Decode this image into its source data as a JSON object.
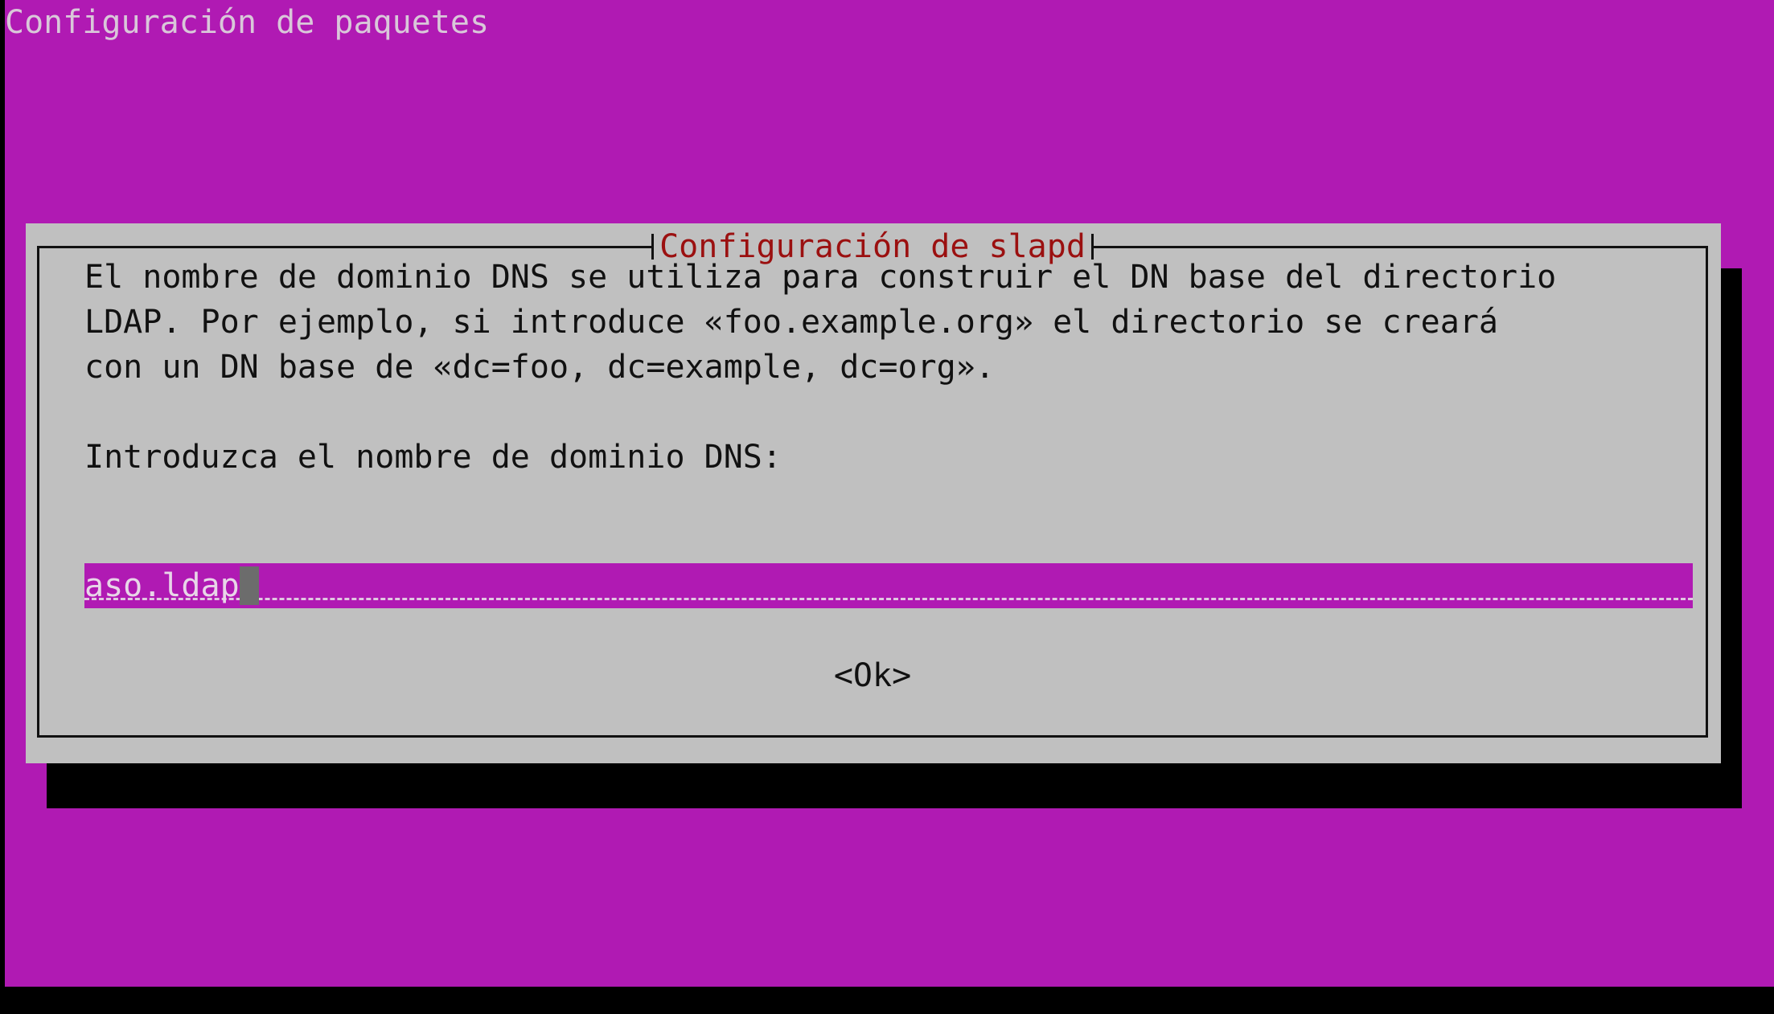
{
  "screen": {
    "backtitle": "Configuración de paquetes"
  },
  "dialog": {
    "title": "Configuración de slapd",
    "description_lines": [
      "El nombre de dominio DNS se utiliza para construir el DN base del directorio",
      "LDAP. Por ejemplo, si introduce «foo.example.org» el directorio se creará",
      "con un DN base de «dc=foo, dc=example, dc=org»."
    ],
    "prompt": "Introduzca el nombre de dominio DNS:",
    "input_value": "aso.ldap",
    "ok_label": "<Ok>"
  },
  "colors": {
    "background": "#b01ab3",
    "dialog": "#c0c0c0",
    "title": "#9b1010",
    "shadow": "#000000"
  }
}
